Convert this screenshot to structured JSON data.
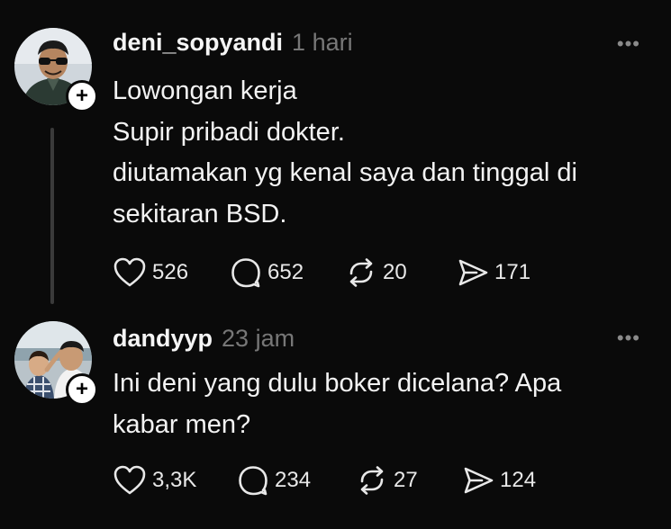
{
  "posts": [
    {
      "username": "deni_sopyandi",
      "timestamp": "1 hari",
      "lines": [
        "Lowongan kerja",
        "Supir pribadi dokter.",
        "diutamakan yg kenal saya dan tinggal di",
        "sekitaran BSD."
      ],
      "likes": "526",
      "comments": "652",
      "reposts": "20",
      "shares": "171"
    },
    {
      "username": "dandyyp",
      "timestamp": "23 jam",
      "lines": [
        "Ini deni yang dulu boker dicelana? Apa",
        "kabar men?"
      ],
      "likes": "3,3K",
      "comments": "234",
      "reposts": "27",
      "shares": "124"
    }
  ],
  "ui": {
    "follow_symbol": "+",
    "more_symbol": "•••"
  },
  "icons": [
    "heart-icon",
    "comment-icon",
    "repost-icon",
    "share-icon",
    "more-icon",
    "plus-icon"
  ]
}
